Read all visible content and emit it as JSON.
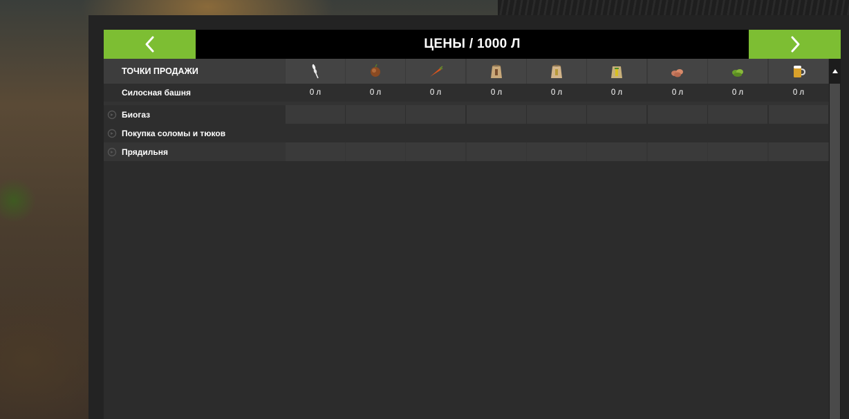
{
  "title": "ЦЕНЫ / 1000 Л",
  "nav": {
    "prev_icon": "chevron-left-icon",
    "next_icon": "chevron-right-icon",
    "accent_color": "#7dbe33"
  },
  "table": {
    "header_label": "ТОЧКИ ПРОДАЖИ",
    "columns": [
      {
        "icon": "wheat-icon"
      },
      {
        "icon": "barley-icon"
      },
      {
        "icon": "canola-icon"
      },
      {
        "icon": "grain-sack-icon"
      },
      {
        "icon": "grain-sack-icon"
      },
      {
        "icon": "corn-sack-icon"
      },
      {
        "icon": "potato-icon"
      },
      {
        "icon": "grass-icon"
      },
      {
        "icon": "beer-mug-icon"
      }
    ],
    "rows": [
      {
        "name": "Силосная башня",
        "values": [
          "0 л",
          "0 л",
          "0 л",
          "0 л",
          "0 л",
          "0 л",
          "0 л",
          "0 л",
          "0 л"
        ]
      },
      {
        "name": "Биогаз",
        "values": [
          "",
          "",
          "",
          "",
          "",
          "",
          "",
          "",
          ""
        ]
      },
      {
        "name": "Покупка соломы и тюков",
        "values": []
      },
      {
        "name": "Прядильня",
        "values": [
          "",
          "",
          "",
          "",
          "",
          "",
          "",
          "",
          ""
        ]
      }
    ]
  }
}
